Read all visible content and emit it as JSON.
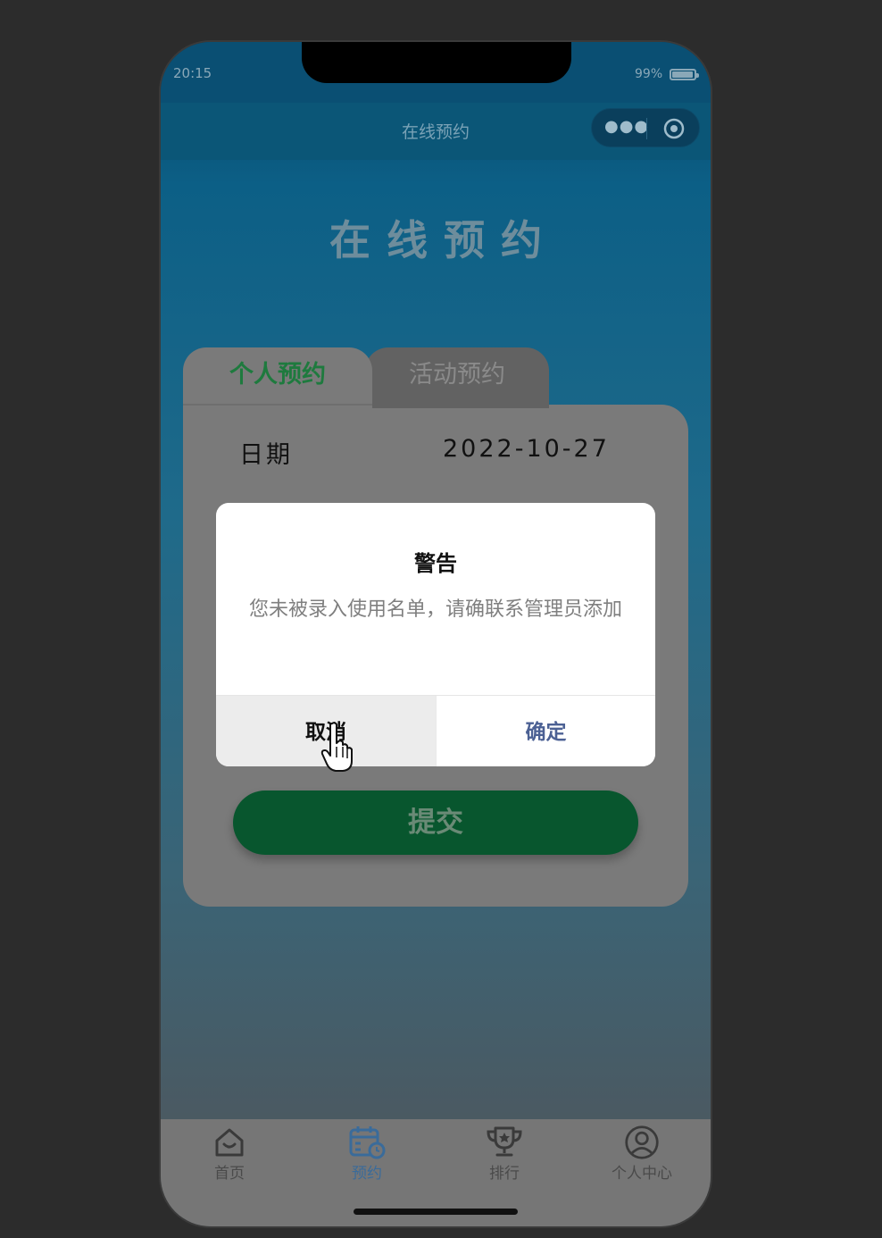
{
  "status_bar": {
    "time": "20:15",
    "battery_pct": "99%"
  },
  "nav": {
    "title": "在线预约",
    "menu_icon": "more-dots-icon",
    "close_icon": "target-circle-icon"
  },
  "headline": "在线预约",
  "tabs": [
    {
      "label": "个人预约",
      "active": true
    },
    {
      "label": "活动预约",
      "active": false
    }
  ],
  "form": {
    "date_label": "日期",
    "date_value": "2022-10-27",
    "submit_label": "提交"
  },
  "dialog": {
    "title": "警告",
    "message": "您未被录入使用名单，请确联系管理员添加",
    "cancel_label": "取消",
    "ok_label": "确定"
  },
  "tabbar": {
    "items": [
      {
        "label": "首页",
        "icon": "home-icon",
        "active": false
      },
      {
        "label": "预约",
        "icon": "calendar-clock-icon",
        "active": true
      },
      {
        "label": "排行",
        "icon": "trophy-icon",
        "active": false
      },
      {
        "label": "个人中心",
        "icon": "user-circle-icon",
        "active": false
      }
    ]
  },
  "colors": {
    "accent_green": "#08562e",
    "active_tab_text": "#1e7a3e",
    "ok_button": "#4c6194",
    "tabbar_active": "#3a6b9a"
  }
}
